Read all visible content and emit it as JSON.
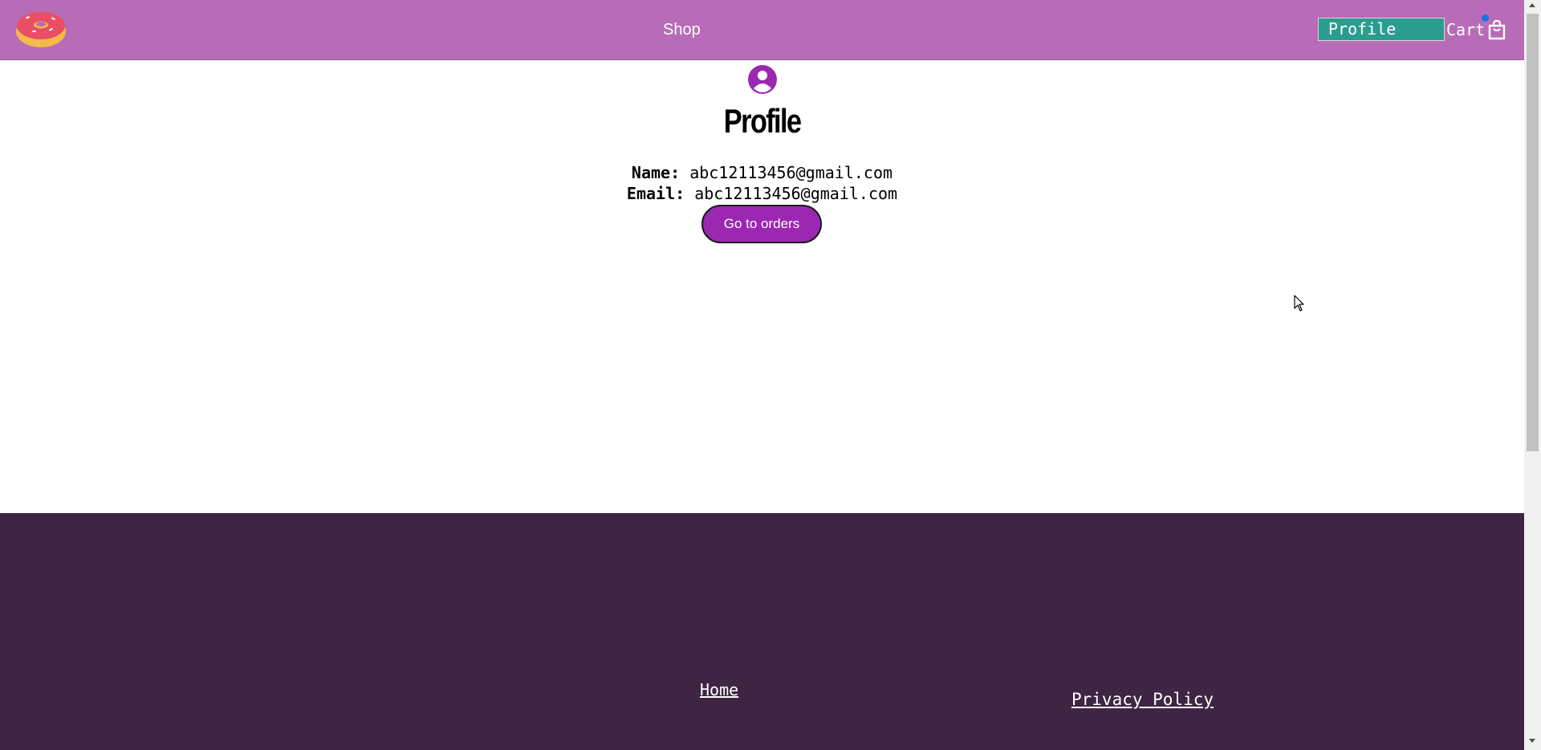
{
  "header": {
    "logo": "donut-logo",
    "nav": {
      "shop_label": "Shop",
      "profile_label": "Profile",
      "cart_label": "Cart"
    },
    "cart_icon": "shopping-bag-icon",
    "colors": {
      "bar": "#b86cb7",
      "profile_bg": "#2a9d8f",
      "badge": "#1a73e8"
    }
  },
  "main": {
    "avatar_icon": "user-circle-icon",
    "title": "Profile",
    "name_label": "Name:",
    "name_value": "abc12113456@gmail.com",
    "email_label": "Email:",
    "email_value": "abc12113456@gmail.com",
    "orders_button": "Go to orders",
    "colors": {
      "accent": "#9c27b0"
    }
  },
  "footer": {
    "home_link": "Home",
    "privacy_link": "Privacy Policy",
    "colors": {
      "bg": "#3f2544"
    }
  }
}
